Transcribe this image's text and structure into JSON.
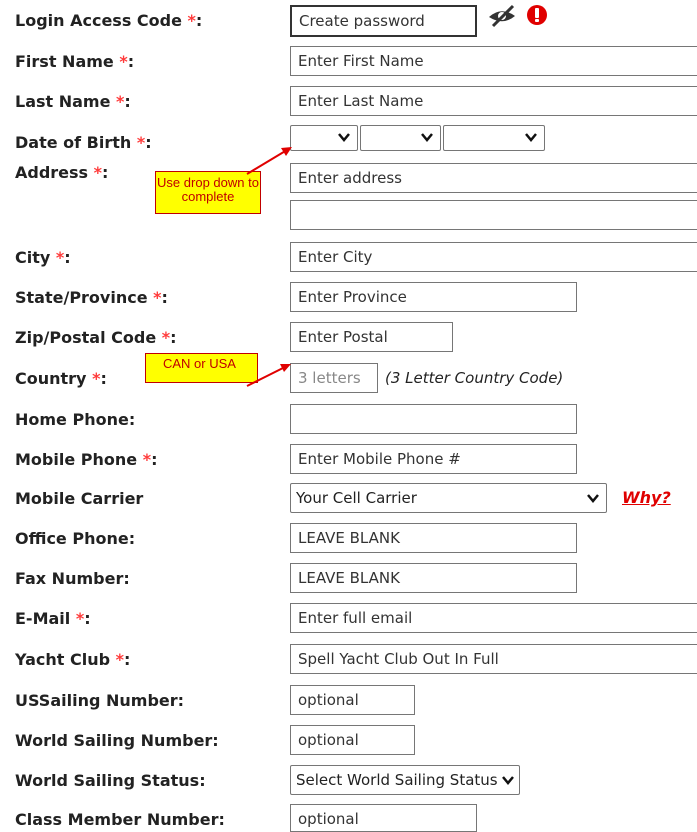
{
  "fields": {
    "login": {
      "label": "Login Access Code",
      "placeholder": "Create password"
    },
    "first_name": {
      "label": "First Name",
      "placeholder": "Enter First Name"
    },
    "last_name": {
      "label": "Last Name",
      "placeholder": "Enter Last Name"
    },
    "dob": {
      "label": "Date of Birth"
    },
    "address": {
      "label": "Address",
      "placeholder": "Enter address",
      "placeholder2": ""
    },
    "city": {
      "label": "City",
      "placeholder": "Enter City"
    },
    "state": {
      "label": "State/Province",
      "placeholder": "Enter Province"
    },
    "zip": {
      "label": "Zip/Postal Code",
      "placeholder": "Enter Postal"
    },
    "country": {
      "label": "Country",
      "placeholder": "3 letters",
      "hint": "(3 Letter Country Code)"
    },
    "home_phone": {
      "label": "Home Phone:",
      "placeholder": ""
    },
    "mobile_phone": {
      "label": "Mobile Phone",
      "placeholder": "Enter Mobile Phone #"
    },
    "mobile_carrier": {
      "label": "Mobile Carrier",
      "selected": "Your Cell Carrier",
      "link": "Why?"
    },
    "office_phone": {
      "label": "Office Phone:",
      "value": "LEAVE BLANK"
    },
    "fax": {
      "label": "Fax Number:",
      "value": "LEAVE BLANK"
    },
    "email": {
      "label": "E-Mail",
      "placeholder": "Enter full email"
    },
    "yacht_club": {
      "label": "Yacht Club",
      "value": "Spell Yacht Club Out In Full"
    },
    "ussailing": {
      "label": "USSailing Number:",
      "placeholder": "optional"
    },
    "world_sailing_number": {
      "label": "World Sailing Number:",
      "placeholder": "optional"
    },
    "world_sailing_status": {
      "label": "World Sailing Status:",
      "selected": "Select World Sailing Status"
    },
    "class_member": {
      "label": "Class Member Number:",
      "placeholder": "optional"
    }
  },
  "required_mark": "*",
  "colon": ":",
  "annotations": {
    "dob_note": "Use drop down to complete",
    "country_note": "CAN or USA"
  },
  "icons": {
    "password_toggle": "eye-slash-icon",
    "alert": "alert-icon"
  },
  "colors": {
    "required": "#ff3b3b",
    "note_bg": "#ffff00",
    "note_text": "#c00000",
    "link": "#e00000"
  }
}
